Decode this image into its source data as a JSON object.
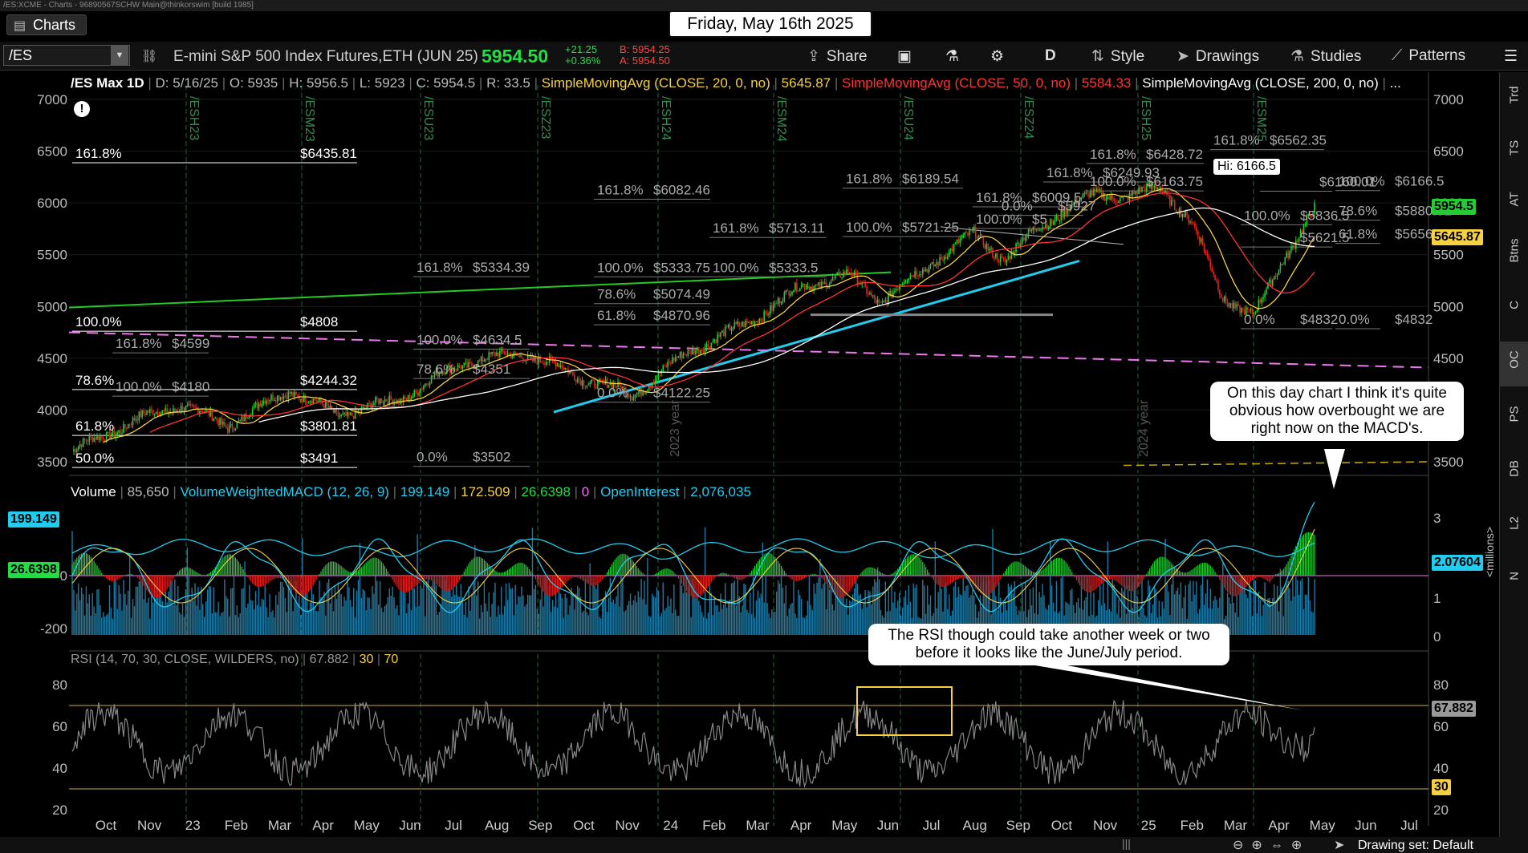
{
  "window": {
    "title": "/ES:XCME - Charts - 96890567SCHW Main@thinkorswim [build 1985]"
  },
  "tab": {
    "label": "Charts"
  },
  "date_label": "Friday, May 16th 2025",
  "toolbar": {
    "symbol": "/ES",
    "instrument": "E-mini S&P 500 Index Futures,ETH (JUN 25)",
    "last": "5954.50",
    "change": "+21.25",
    "change_pct": "+0.36%",
    "bid": "B: 5954.25",
    "ask": "A: 5954.50",
    "share": "Share",
    "period": "D",
    "style": "Style",
    "drawings": "Drawings",
    "studies": "Studies",
    "patterns": "Patterns"
  },
  "price_header": {
    "symbol": "/ES Max 1D",
    "date": "D: 5/16/25",
    "open": "O: 5935",
    "high": "H: 5956.5",
    "low": "L: 5923",
    "close": "C: 5954.5",
    "range": "R: 33.5",
    "sma20_label": "SimpleMovingAvg (CLOSE, 20, 0, no)",
    "sma20_value": "5645.87",
    "sma50_label": "SimpleMovingAvg (CLOSE, 50, 0, no)",
    "sma50_value": "5584.33",
    "sma200_label": "SimpleMovingAvg (CLOSE, 200, 0, no)",
    "ellipsis": "..."
  },
  "macd_header": {
    "volume_label": "Volume",
    "volume_value": "85,650",
    "macd_label": "VolumeWeightedMACD (12, 26, 9)",
    "v1": "199.149",
    "v2": "172.509",
    "v3": "26.6398",
    "v4": "0",
    "oi_label": "OpenInterest",
    "oi_value": "2,076,035"
  },
  "rsi_header": {
    "label": "RSI (14, 70, 30, CLOSE, WILDERS, no)",
    "value": "67.882",
    "low": "30",
    "high": "70"
  },
  "price_axis": [
    "7000",
    "6500",
    "6000",
    "5500",
    "5000",
    "4500",
    "4000",
    "3500"
  ],
  "price_tags": {
    "last": "5954.5",
    "sma": "5645.87"
  },
  "macd_axis_left": [
    "199.149",
    "26.6398",
    "0",
    "-200"
  ],
  "macd_axis_right": [
    "3",
    "2.07604",
    "1",
    "0"
  ],
  "macd_units": "<millions>",
  "rsi_axis": [
    "80",
    "67.882",
    "60",
    "40",
    "30",
    "20"
  ],
  "rsi_axis_left": [
    "80",
    "60",
    "40",
    "20"
  ],
  "x_axis": [
    "Oct",
    "Nov",
    "23",
    "Feb",
    "Mar",
    "Apr",
    "May",
    "Jun",
    "Jul",
    "Aug",
    "Sep",
    "Oct",
    "Nov",
    "24",
    "Feb",
    "Mar",
    "Apr",
    "May",
    "Jun",
    "Jul",
    "Aug",
    "Sep",
    "Oct",
    "Nov",
    "25",
    "Feb",
    "Mar",
    "Apr",
    "May",
    "Jun",
    "Jul"
  ],
  "contract_labels": [
    "/ESH23",
    "/ESM23",
    "/ESU23",
    "/ESZ23",
    "/ESH24",
    "/ESM24",
    "/ESU24",
    "/ESZ24",
    "/ESH25",
    "/ESM25"
  ],
  "year_labels": [
    "2023 year",
    "2024 year"
  ],
  "fib_labels": [
    {
      "pct": "161.8%",
      "price": "$6435.81"
    },
    {
      "pct": "100.0%",
      "price": "$4808"
    },
    {
      "pct": "78.6%",
      "price": "$4244.32"
    },
    {
      "pct": "61.8%",
      "price": "$3801.81"
    },
    {
      "pct": "50.0%",
      "price": "$3491"
    },
    {
      "pct": "161.8%",
      "price": "$4599"
    },
    {
      "pct": "100.0%",
      "price": "$4180"
    },
    {
      "pct": "161.8%",
      "price": "$5334.39"
    },
    {
      "pct": "100.0%",
      "price": "$4634.5"
    },
    {
      "pct": "78.6%",
      "price": "$4351"
    },
    {
      "pct": "0.0%",
      "price": "$3502"
    },
    {
      "pct": "161.8%",
      "price": "$6082.46"
    },
    {
      "pct": "100.0%",
      "price": "$5333.75"
    },
    {
      "pct": "78.6%",
      "price": "$5074.49"
    },
    {
      "pct": "61.8%",
      "price": "$4870.96"
    },
    {
      "pct": "0.0%",
      "price": "$4122.25"
    },
    {
      "pct": "161.8%",
      "price": "$5713.11"
    },
    {
      "pct": "100.0%",
      "price": "$5333.5"
    },
    {
      "pct": "161.8%",
      "price": "$6189.54"
    },
    {
      "pct": "100.0%",
      "price": "$5721.25"
    },
    {
      "pct": "161.8%",
      "price": "$6009.5"
    },
    {
      "pct": "0.0%",
      "price": "$5927"
    },
    {
      "pct": "100.0%",
      "price": "$5"
    },
    {
      "pct": "161.8%",
      "price": "$6249.93"
    },
    {
      "pct": "161.8%",
      "price": "$6428.72"
    },
    {
      "pct": "100.0%",
      "price": "$6163.75"
    },
    {
      "pct": "161.8%",
      "price": "$6562.35"
    },
    {
      "pct": "",
      "price": "$6160.01"
    },
    {
      "pct": "100.0%",
      "price": "$6166.5"
    },
    {
      "pct": "78.6%",
      "price": "$5880.92"
    },
    {
      "pct": "61.8%",
      "price": "$5656.72"
    },
    {
      "pct": "100.0%",
      "price": "$5836.5"
    },
    {
      "pct": "",
      "price": "$5621.5"
    },
    {
      "pct": "0.0%",
      "price": "$4832"
    },
    {
      "pct": "0.0%",
      "price": "$4832"
    }
  ],
  "hi_tag": "Hi: 6166.5",
  "annotations": {
    "macd_note": "On this day chart I think it's quite obvious how overbought we are right now on the MACD's.",
    "rsi_note": "The RSI though could take another week or two before it looks like the June/July period."
  },
  "bottom": {
    "drawing_set": "Drawing set: Default"
  },
  "colors": {
    "up": "#22dd44",
    "down": "#ff3333",
    "sma20": "#f5d142",
    "sma50": "#ff3333",
    "sma200": "#ffffff",
    "trend_cyan": "#22ccee",
    "trend_green": "#22cc22",
    "magenta": "#ee77ee"
  }
}
